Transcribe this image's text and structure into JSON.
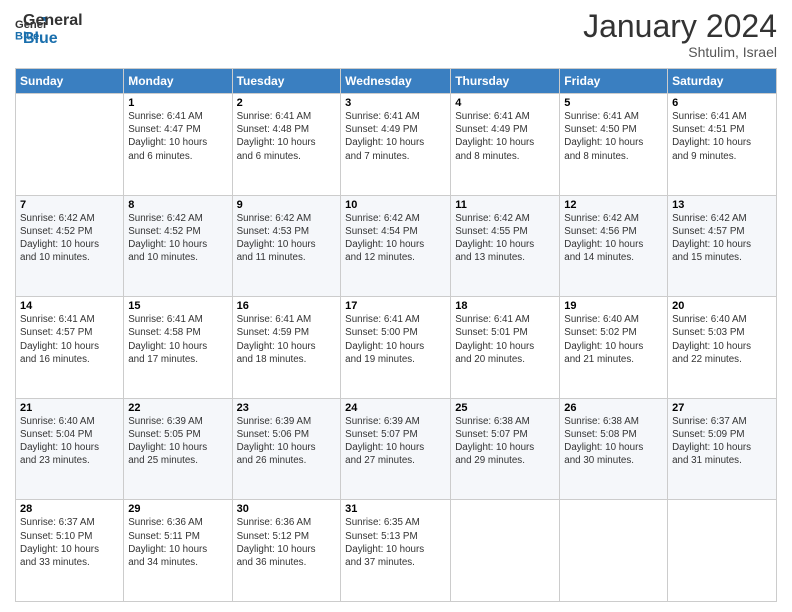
{
  "logo": {
    "line1": "General",
    "line2": "Blue"
  },
  "title": "January 2024",
  "location": "Shtulim, Israel",
  "days_header": [
    "Sunday",
    "Monday",
    "Tuesday",
    "Wednesday",
    "Thursday",
    "Friday",
    "Saturday"
  ],
  "weeks": [
    [
      {
        "num": "",
        "info": ""
      },
      {
        "num": "1",
        "info": "Sunrise: 6:41 AM\nSunset: 4:47 PM\nDaylight: 10 hours\nand 6 minutes."
      },
      {
        "num": "2",
        "info": "Sunrise: 6:41 AM\nSunset: 4:48 PM\nDaylight: 10 hours\nand 6 minutes."
      },
      {
        "num": "3",
        "info": "Sunrise: 6:41 AM\nSunset: 4:49 PM\nDaylight: 10 hours\nand 7 minutes."
      },
      {
        "num": "4",
        "info": "Sunrise: 6:41 AM\nSunset: 4:49 PM\nDaylight: 10 hours\nand 8 minutes."
      },
      {
        "num": "5",
        "info": "Sunrise: 6:41 AM\nSunset: 4:50 PM\nDaylight: 10 hours\nand 8 minutes."
      },
      {
        "num": "6",
        "info": "Sunrise: 6:41 AM\nSunset: 4:51 PM\nDaylight: 10 hours\nand 9 minutes."
      }
    ],
    [
      {
        "num": "7",
        "info": "Sunrise: 6:42 AM\nSunset: 4:52 PM\nDaylight: 10 hours\nand 10 minutes."
      },
      {
        "num": "8",
        "info": "Sunrise: 6:42 AM\nSunset: 4:52 PM\nDaylight: 10 hours\nand 10 minutes."
      },
      {
        "num": "9",
        "info": "Sunrise: 6:42 AM\nSunset: 4:53 PM\nDaylight: 10 hours\nand 11 minutes."
      },
      {
        "num": "10",
        "info": "Sunrise: 6:42 AM\nSunset: 4:54 PM\nDaylight: 10 hours\nand 12 minutes."
      },
      {
        "num": "11",
        "info": "Sunrise: 6:42 AM\nSunset: 4:55 PM\nDaylight: 10 hours\nand 13 minutes."
      },
      {
        "num": "12",
        "info": "Sunrise: 6:42 AM\nSunset: 4:56 PM\nDaylight: 10 hours\nand 14 minutes."
      },
      {
        "num": "13",
        "info": "Sunrise: 6:42 AM\nSunset: 4:57 PM\nDaylight: 10 hours\nand 15 minutes."
      }
    ],
    [
      {
        "num": "14",
        "info": "Sunrise: 6:41 AM\nSunset: 4:57 PM\nDaylight: 10 hours\nand 16 minutes."
      },
      {
        "num": "15",
        "info": "Sunrise: 6:41 AM\nSunset: 4:58 PM\nDaylight: 10 hours\nand 17 minutes."
      },
      {
        "num": "16",
        "info": "Sunrise: 6:41 AM\nSunset: 4:59 PM\nDaylight: 10 hours\nand 18 minutes."
      },
      {
        "num": "17",
        "info": "Sunrise: 6:41 AM\nSunset: 5:00 PM\nDaylight: 10 hours\nand 19 minutes."
      },
      {
        "num": "18",
        "info": "Sunrise: 6:41 AM\nSunset: 5:01 PM\nDaylight: 10 hours\nand 20 minutes."
      },
      {
        "num": "19",
        "info": "Sunrise: 6:40 AM\nSunset: 5:02 PM\nDaylight: 10 hours\nand 21 minutes."
      },
      {
        "num": "20",
        "info": "Sunrise: 6:40 AM\nSunset: 5:03 PM\nDaylight: 10 hours\nand 22 minutes."
      }
    ],
    [
      {
        "num": "21",
        "info": "Sunrise: 6:40 AM\nSunset: 5:04 PM\nDaylight: 10 hours\nand 23 minutes."
      },
      {
        "num": "22",
        "info": "Sunrise: 6:39 AM\nSunset: 5:05 PM\nDaylight: 10 hours\nand 25 minutes."
      },
      {
        "num": "23",
        "info": "Sunrise: 6:39 AM\nSunset: 5:06 PM\nDaylight: 10 hours\nand 26 minutes."
      },
      {
        "num": "24",
        "info": "Sunrise: 6:39 AM\nSunset: 5:07 PM\nDaylight: 10 hours\nand 27 minutes."
      },
      {
        "num": "25",
        "info": "Sunrise: 6:38 AM\nSunset: 5:07 PM\nDaylight: 10 hours\nand 29 minutes."
      },
      {
        "num": "26",
        "info": "Sunrise: 6:38 AM\nSunset: 5:08 PM\nDaylight: 10 hours\nand 30 minutes."
      },
      {
        "num": "27",
        "info": "Sunrise: 6:37 AM\nSunset: 5:09 PM\nDaylight: 10 hours\nand 31 minutes."
      }
    ],
    [
      {
        "num": "28",
        "info": "Sunrise: 6:37 AM\nSunset: 5:10 PM\nDaylight: 10 hours\nand 33 minutes."
      },
      {
        "num": "29",
        "info": "Sunrise: 6:36 AM\nSunset: 5:11 PM\nDaylight: 10 hours\nand 34 minutes."
      },
      {
        "num": "30",
        "info": "Sunrise: 6:36 AM\nSunset: 5:12 PM\nDaylight: 10 hours\nand 36 minutes."
      },
      {
        "num": "31",
        "info": "Sunrise: 6:35 AM\nSunset: 5:13 PM\nDaylight: 10 hours\nand 37 minutes."
      },
      {
        "num": "",
        "info": ""
      },
      {
        "num": "",
        "info": ""
      },
      {
        "num": "",
        "info": ""
      }
    ]
  ]
}
